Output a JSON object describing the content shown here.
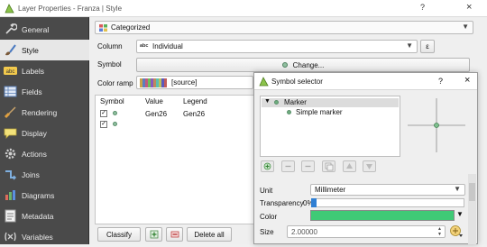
{
  "window": {
    "title": "Layer Properties - Franza | Style",
    "help": "?",
    "close": "×"
  },
  "sidebar": {
    "items": [
      {
        "label": "General",
        "icon": "wrench-icon"
      },
      {
        "label": "Style",
        "icon": "paintbrush-icon"
      },
      {
        "label": "Labels",
        "icon": "abc-label-icon"
      },
      {
        "label": "Fields",
        "icon": "table-fields-icon"
      },
      {
        "label": "Rendering",
        "icon": "brush-icon"
      },
      {
        "label": "Display",
        "icon": "speech-bubble-icon"
      },
      {
        "label": "Actions",
        "icon": "gear-icon"
      },
      {
        "label": "Joins",
        "icon": "join-icon"
      },
      {
        "label": "Diagrams",
        "icon": "chart-icon"
      },
      {
        "label": "Metadata",
        "icon": "info-icon"
      },
      {
        "label": "Variables",
        "icon": "variables-icon"
      }
    ],
    "active_index": 1
  },
  "style": {
    "renderer": "Categorized",
    "column_label": "Column",
    "column_value": "Individual",
    "column_type_glyph": "abc",
    "expression_button": "ε",
    "symbol_label": "Symbol",
    "symbol_button": "Change...",
    "color_ramp_label": "Color ramp",
    "color_ramp_value": "[source]",
    "table_headers": [
      "Symbol",
      "Value",
      "Legend"
    ],
    "rows": [
      {
        "value": "Gen26",
        "legend": "Gen26",
        "checked": true
      },
      {
        "value": "",
        "legend": "",
        "checked": true
      }
    ],
    "classify_button": "Classify",
    "delete_all_button": "Delete all",
    "symbol_color": "#8fbf9f"
  },
  "symbol_selector": {
    "title": "Symbol selector",
    "help": "?",
    "close": "×",
    "tree": {
      "root": "Marker",
      "child": "Simple marker"
    },
    "unit_label": "Unit",
    "unit_value": "Millimeter",
    "transparency_label": "Transparency",
    "transparency_value": "0%",
    "transparency_fraction": 0.0,
    "color_label": "Color",
    "color_value": "#3fca76",
    "size_label": "Size",
    "size_value": "2.00000"
  }
}
